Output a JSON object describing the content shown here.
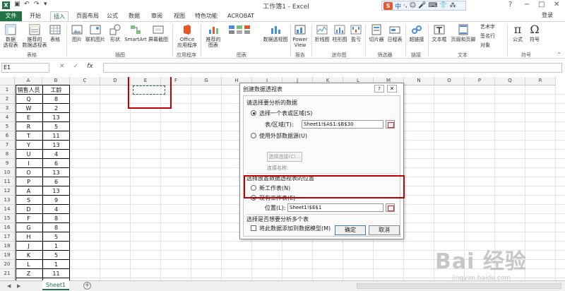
{
  "window": {
    "title": "工作簿1 - Excel",
    "login": "登录",
    "min": "−",
    "max": "□",
    "close": "✕",
    "help": "?"
  },
  "quick_access": [
    "save",
    "undo",
    "redo",
    "customize"
  ],
  "ime": {
    "label": "S",
    "items": [
      "中",
      "·,",
      "☺",
      "🎤",
      "⌨",
      "👕",
      "⁂"
    ]
  },
  "tabs": [
    "文件",
    "开始",
    "插入",
    "页面布局",
    "公式",
    "数据",
    "审阅",
    "视图",
    "特色功能",
    "ACROBAT"
  ],
  "active_tab": "插入",
  "ribbon": {
    "buttons": [
      "数据\n透视表",
      "推荐的\n数据透视表",
      "表格",
      "图片",
      "联机图片",
      "形状",
      "SmartArt",
      "屏幕截图",
      "Office\n应用程序",
      "推荐的\n图表",
      "数据透视图",
      "Power\nView",
      "折线图",
      "柱形图",
      "盈亏",
      "切片器",
      "日程表",
      "超链接",
      "文本框",
      "页眉和页脚",
      "公式",
      "符号"
    ],
    "side_items": [
      "艺术字",
      "签名行",
      "对象"
    ],
    "groups": [
      "表格",
      "插图",
      "应用程序",
      "图表",
      "报告",
      "迷你图",
      "筛选器",
      "链接",
      "文本",
      "符号"
    ]
  },
  "formula_bar": {
    "namebox": "E1",
    "cancel": "✕",
    "enter": "✓",
    "fx": "fx",
    "value": ""
  },
  "columns": [
    "A",
    "B",
    "C",
    "D",
    "E",
    "F",
    "G",
    "H",
    "I",
    "J",
    "K",
    "L",
    "M",
    "N",
    "O",
    "P",
    "Q",
    "R"
  ],
  "rows": [
    "1",
    "2",
    "3",
    "4",
    "5",
    "6",
    "7",
    "8",
    "9",
    "10",
    "11",
    "12",
    "13",
    "14",
    "15",
    "16",
    "17",
    "18",
    "19",
    "20",
    "21",
    "22"
  ],
  "table": {
    "headers": [
      "销售人员",
      "工龄"
    ],
    "data": [
      [
        "Q",
        "8"
      ],
      [
        "W",
        "2"
      ],
      [
        "E",
        "13"
      ],
      [
        "R",
        "5"
      ],
      [
        "T",
        "11"
      ],
      [
        "Y",
        "13"
      ],
      [
        "U",
        "4"
      ],
      [
        "I",
        "6"
      ],
      [
        "O",
        "13"
      ],
      [
        "P",
        "6"
      ],
      [
        "A",
        "13"
      ],
      [
        "S",
        "9"
      ],
      [
        "D",
        "4"
      ],
      [
        "F",
        "8"
      ],
      [
        "G",
        "8"
      ],
      [
        "H",
        "5"
      ],
      [
        "J",
        "1"
      ],
      [
        "K",
        "5"
      ],
      [
        "L",
        "1"
      ],
      [
        "Z",
        "11"
      ],
      [
        "X",
        "1"
      ]
    ]
  },
  "dialog": {
    "title": "创建数据透视表",
    "section1": "请选择要分析的数据",
    "opt_range": "选择一个表或区域(S)",
    "range_label": "表/区域(T):",
    "range_value": "Sheet1!$A$1:$B$30",
    "opt_external": "使用外部数据源(U)",
    "choose_conn": "选择连接(C)...",
    "conn_name": "连接名称:",
    "section2": "选择放置数据透视表的位置",
    "opt_new": "新工作表(N)",
    "opt_existing": "现有工作表(E)",
    "loc_label": "位置(L):",
    "loc_value": "Sheet1!$E$1",
    "section3": "选择是否想要分析多个表",
    "chk_model": "将此数据添加到数据模型(M)",
    "ok": "确定",
    "cancel": "取消",
    "help_btn": "?",
    "close_btn": "✕"
  },
  "sheet": {
    "tab": "Sheet1",
    "add": "+",
    "nav_prev": "◀",
    "nav_next": "▶"
  },
  "watermark": {
    "big": "Bai 经验",
    "small": "jingyan.baidu.com"
  },
  "colors": {
    "excel_green": "#217346",
    "highlight_red": "#c00000"
  }
}
